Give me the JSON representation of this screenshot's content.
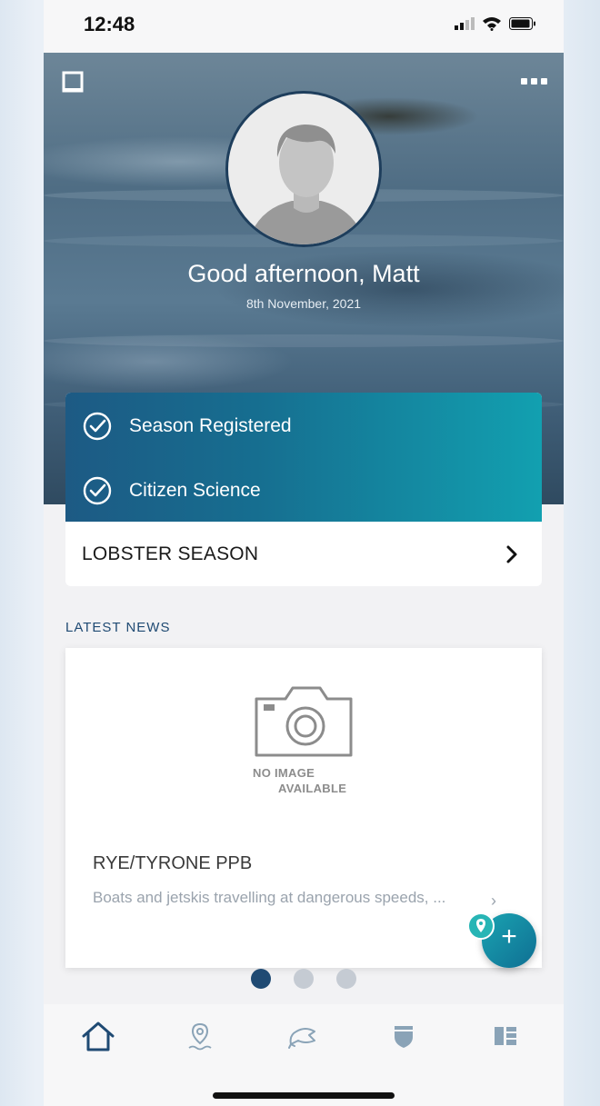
{
  "status_bar": {
    "time": "12:48"
  },
  "profile": {
    "greeting": "Good afternoon, Matt",
    "date": "8th November, 2021"
  },
  "season": {
    "status_items": [
      {
        "label": "Season Registered",
        "icon": "check-circle-icon"
      },
      {
        "label": "Citizen Science",
        "icon": "check-circle-icon"
      }
    ],
    "title": "LOBSTER SEASON"
  },
  "news": {
    "section_title": "LATEST NEWS",
    "placeholder": {
      "line1": "NO IMAGE",
      "line2": "AVAILABLE"
    },
    "title": "RYE/TYRONE PPB",
    "body": "Boats and jetskis travelling at dangerous speeds, ...",
    "carousel": {
      "pages": 3,
      "active": 1
    }
  },
  "fab": {
    "label": "+"
  },
  "tabs": [
    {
      "name": "home",
      "icon": "home-icon",
      "active": true
    },
    {
      "name": "locations",
      "icon": "map-pin-icon"
    },
    {
      "name": "catch",
      "icon": "fish-icon"
    },
    {
      "name": "rules",
      "icon": "shield-icon"
    },
    {
      "name": "more",
      "icon": "grid-icon"
    }
  ],
  "colors": {
    "accent": "#1f4a73",
    "teal": "#12a0b0",
    "active_dot": "#1f4a73",
    "inactive_dot": "#c5cbd3",
    "tab_icon_inactive": "#8aa3b7"
  }
}
